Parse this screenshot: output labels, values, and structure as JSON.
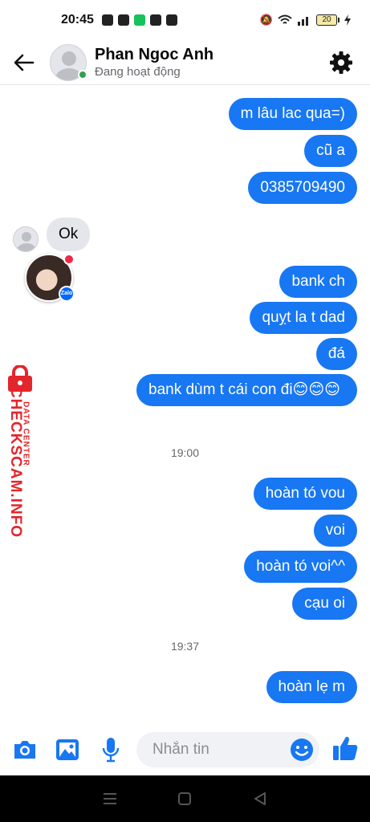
{
  "status_bar": {
    "time": "20:45",
    "battery": "20"
  },
  "header": {
    "name": "Phan Ngoc Anh",
    "status": "Đang hoạt động"
  },
  "messages": {
    "out1": "m lâu lac qua=)",
    "out2": "cũ a",
    "out3": "0385709490",
    "in1": "Ok",
    "out4": "bank ch",
    "out5": "quỵt la t dad",
    "out6": "đá",
    "out7": "bank dùm t cái con đi😊😊😊",
    "time1": "19:00",
    "out8": "hoàn tó vou",
    "out9": "voi",
    "out10": "hoàn tó voi^^",
    "out11": "cạu oi",
    "time2": "19:37",
    "out12": "hoàn lẹ m"
  },
  "chathead": {
    "app_label": "Zalo"
  },
  "watermark": {
    "main": "CHECKSCAM.INFO",
    "sub": "DATA CENTER"
  },
  "composer": {
    "placeholder": "Nhắn tin"
  },
  "colors": {
    "accent": "#1877f2",
    "online": "#31a24c",
    "incoming_bg": "#e4e6eb",
    "watermark": "#e3262b"
  },
  "icons": {
    "header": [
      "back-arrow-icon",
      "settings-gear-icon"
    ],
    "composer": [
      "camera-icon",
      "image-icon",
      "microphone-icon",
      "emoji-icon",
      "thumbs-up-icon"
    ],
    "nav": [
      "recents-icon",
      "home-icon",
      "back-icon"
    ]
  }
}
